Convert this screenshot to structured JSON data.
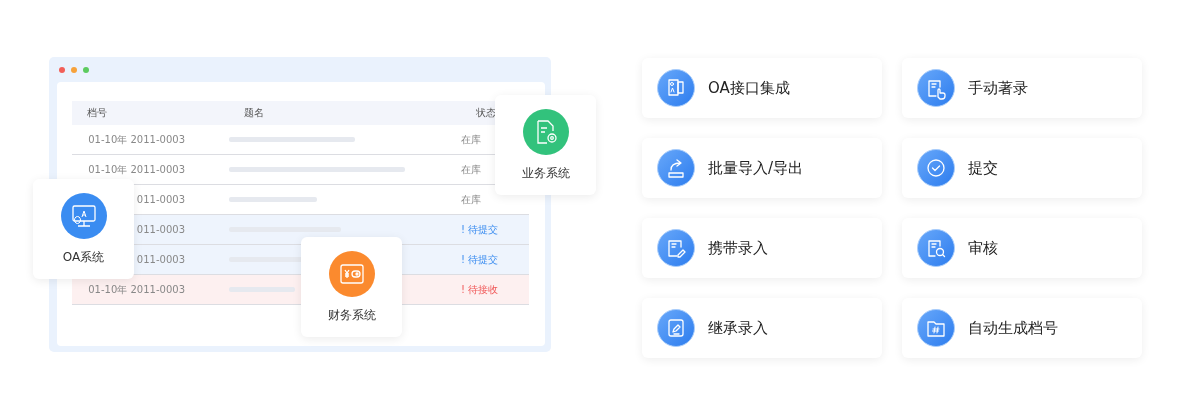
{
  "window": {
    "table": {
      "columns": [
        "档号",
        "题名",
        "状态"
      ],
      "rows": [
        {
          "kind": "normal",
          "number": "01-10年 2011-0003",
          "status": "在库"
        },
        {
          "kind": "normal",
          "number": "01-10年 2011-0003",
          "status": "在库"
        },
        {
          "kind": "normal",
          "number": "011-0003",
          "status": "在库"
        },
        {
          "kind": "pending",
          "number": "011-0003",
          "status": "! 待提交"
        },
        {
          "kind": "pending",
          "number": "011-0003",
          "status": "! 待提交"
        },
        {
          "kind": "alert",
          "number": "01-10年 2011-0003",
          "status": "! 待接收"
        }
      ]
    }
  },
  "systems": [
    {
      "kind": "oa",
      "label": "OA系统"
    },
    {
      "kind": "business",
      "label": "业务系统"
    },
    {
      "kind": "finance",
      "label": "财务系统"
    }
  ],
  "features": [
    {
      "label": "OA接口集成"
    },
    {
      "label": "手动著录"
    },
    {
      "label": "批量导入/导出"
    },
    {
      "label": "提交"
    },
    {
      "label": "携带录入"
    },
    {
      "label": "审核"
    },
    {
      "label": "继承录入"
    },
    {
      "label": "自动生成档号"
    }
  ]
}
